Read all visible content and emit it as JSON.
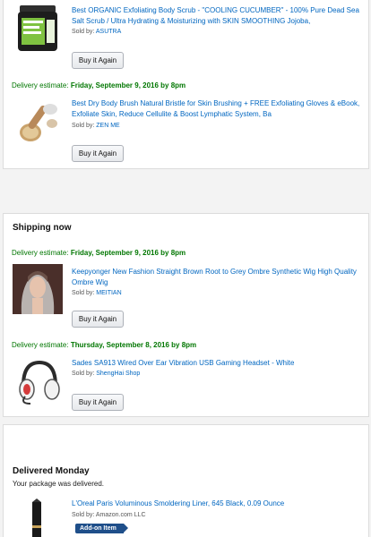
{
  "orders_top": {
    "items": [
      {
        "title": "Best ORGANIC Exfoliating Body Scrub - \"COOLING CUCUMBER\" - 100% Pure Dead Sea Salt Scrub / Ultra Hydrating & Moisturizing with SKIN SMOOTHING Jojoba,",
        "sold_by_label": "Sold by:",
        "seller": "ASUTRA",
        "button": "Buy it Again"
      },
      {
        "delivery_label": "Delivery estimate:",
        "delivery_date": "Friday, September 9, 2016 by 8pm",
        "title": "Best Dry Body Brush Natural Bristle for Skin Brushing + FREE Exfoliating Gloves & eBook, Exfoliate Skin, Reduce Cellulite & Boost Lymphatic System, Ba",
        "sold_by_label": "Sold by:",
        "seller": "ZEN ME",
        "button": "Buy it Again"
      }
    ]
  },
  "shipping_now": {
    "heading": "Shipping now",
    "items": [
      {
        "delivery_label": "Delivery estimate:",
        "delivery_date": "Friday, September 9, 2016 by 8pm",
        "title": "Keepyonger New Fashion Straight Brown Root to Grey Ombre Synthetic Wig High Quality Ombre Wig",
        "sold_by_label": "Sold by:",
        "seller": "MEITIAN",
        "button": "Buy it Again"
      },
      {
        "delivery_label": "Delivery estimate:",
        "delivery_date": "Thursday, September 8, 2016 by 8pm",
        "title": "Sades SA913 Wired Over Ear Vibration USB Gaming Headset - White",
        "sold_by_label": "Sold by:",
        "seller": "ShengHai Shop",
        "button": "Buy it Again"
      }
    ]
  },
  "delivered": {
    "heading": "Delivered Monday",
    "subtext": "Your package was delivered.",
    "items": [
      {
        "title": "L'Oreal Paris Voluminous Smoldering Liner, 645 Black, 0.09 Ounce",
        "sold_by_label": "Sold by:",
        "seller": "Amazon.com LLC",
        "badge": "Add-on Item"
      }
    ]
  },
  "colors": {
    "link": "#0066c0",
    "delivery_green": "#007600",
    "addon_badge": "#1f4f8a",
    "background": "#f3f3f3"
  }
}
